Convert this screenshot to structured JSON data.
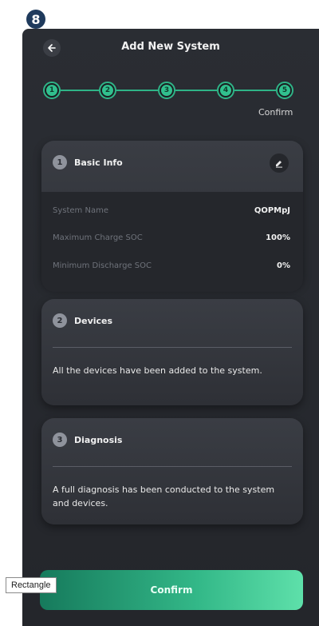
{
  "step_badge": "8",
  "header": {
    "title": "Add New System"
  },
  "stepper": {
    "steps": [
      "1",
      "2",
      "3",
      "4",
      "5"
    ],
    "caption": "Confirm",
    "accent": "#2fb487"
  },
  "cards": {
    "basic": {
      "num": "1",
      "title": "Basic Info",
      "rows": [
        {
          "label": "System Name",
          "value": "QOPMpJ"
        },
        {
          "label": "Maximum Charge SOC",
          "value": "100%"
        },
        {
          "label": "Minimum Discharge SOC",
          "value": "0%"
        }
      ]
    },
    "devices": {
      "num": "2",
      "title": "Devices",
      "text": "All the devices have been added to the system."
    },
    "diagnosis": {
      "num": "3",
      "title": "Diagnosis",
      "text": "A full diagnosis has been conducted to the system and devices."
    }
  },
  "confirm_label": "Confirm",
  "tooltip": "Rectangle",
  "icons": {
    "back": "arrow-left-icon",
    "edit": "pencil-icon"
  }
}
